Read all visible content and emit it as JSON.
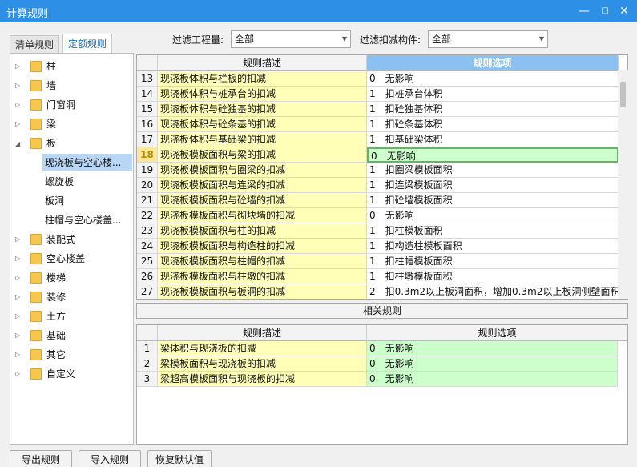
{
  "window": {
    "title": "计算规则"
  },
  "tabs": [
    {
      "label": "清单规则",
      "active": false
    },
    {
      "label": "定额规则",
      "active": true
    }
  ],
  "filters": {
    "quantity_label": "过滤工程量:",
    "quantity_value": "全部",
    "component_label": "过滤扣减构件:",
    "component_value": "全部"
  },
  "tree": [
    {
      "label": "柱",
      "type": "folder",
      "expanded": false
    },
    {
      "label": "墙",
      "type": "folder",
      "expanded": false
    },
    {
      "label": "门窗洞",
      "type": "folder",
      "expanded": false
    },
    {
      "label": "梁",
      "type": "folder",
      "expanded": false
    },
    {
      "label": "板",
      "type": "folder",
      "expanded": true
    },
    {
      "label": "现浇板与空心楼...",
      "type": "child",
      "selected": true
    },
    {
      "label": "螺旋板",
      "type": "child"
    },
    {
      "label": "板洞",
      "type": "child"
    },
    {
      "label": "柱帽与空心楼盖...",
      "type": "child"
    },
    {
      "label": "装配式",
      "type": "folder",
      "expanded": false
    },
    {
      "label": "空心楼盖",
      "type": "folder",
      "expanded": false
    },
    {
      "label": "楼梯",
      "type": "folder",
      "expanded": false
    },
    {
      "label": "装修",
      "type": "folder",
      "expanded": false
    },
    {
      "label": "土方",
      "type": "folder",
      "expanded": false
    },
    {
      "label": "基础",
      "type": "folder",
      "expanded": false
    },
    {
      "label": "其它",
      "type": "folder",
      "expanded": false
    },
    {
      "label": "自定义",
      "type": "folder",
      "expanded": false
    }
  ],
  "main_grid": {
    "headers": {
      "desc": "规则描述",
      "opt": "规则选项"
    },
    "rows": [
      {
        "num": "13",
        "desc": "现浇板体积与栏板的扣减",
        "opt": "0　无影响"
      },
      {
        "num": "14",
        "desc": "现浇板体积与桩承台的扣减",
        "opt": "1　扣桩承台体积"
      },
      {
        "num": "15",
        "desc": "现浇板体积与砼独基的扣减",
        "opt": "1　扣砼独基体积"
      },
      {
        "num": "16",
        "desc": "现浇板体积与砼条基的扣减",
        "opt": "1　扣砼条基体积"
      },
      {
        "num": "17",
        "desc": "现浇板体积与基础梁的扣减",
        "opt": "1　扣基础梁体积"
      },
      {
        "num": "18",
        "desc": "现浇板模板面积与梁的扣减",
        "opt": "0　无影响",
        "selected": true
      },
      {
        "num": "19",
        "desc": "现浇板模板面积与圈梁的扣减",
        "opt": "1　扣圈梁模板面积"
      },
      {
        "num": "20",
        "desc": "现浇板模板面积与连梁的扣减",
        "opt": "1　扣连梁模板面积"
      },
      {
        "num": "21",
        "desc": "现浇板模板面积与砼墙的扣减",
        "opt": "1　扣砼墙模板面积"
      },
      {
        "num": "22",
        "desc": "现浇板模板面积与砌块墙的扣减",
        "opt": "0　无影响"
      },
      {
        "num": "23",
        "desc": "现浇板模板面积与柱的扣减",
        "opt": "1　扣柱模板面积"
      },
      {
        "num": "24",
        "desc": "现浇板模板面积与构造柱的扣减",
        "opt": "1　扣构造柱模板面积"
      },
      {
        "num": "25",
        "desc": "现浇板模板面积与柱帽的扣减",
        "opt": "1　扣柱帽模板面积"
      },
      {
        "num": "26",
        "desc": "现浇板模板面积与柱墩的扣减",
        "opt": "1　扣柱墩模板面积"
      },
      {
        "num": "27",
        "desc": "现浇板模板面积与板洞的扣减",
        "opt": "2　扣0.3m2以上板洞面积，增加0.3m2以上板洞侧壁面积"
      }
    ]
  },
  "related": {
    "title": "相关规则",
    "headers": {
      "desc": "规则描述",
      "opt": "规则选项"
    },
    "rows": [
      {
        "num": "1",
        "desc": "梁体积与现浇板的扣减",
        "opt": "0　无影响"
      },
      {
        "num": "2",
        "desc": "梁模板面积与现浇板的扣减",
        "opt": "0　无影响"
      },
      {
        "num": "3",
        "desc": "梁超高模板面积与现浇板的扣减",
        "opt": "0　无影响"
      }
    ]
  },
  "buttons": {
    "export": "导出规则",
    "import": "导入规则",
    "restore": "恢复默认值"
  }
}
